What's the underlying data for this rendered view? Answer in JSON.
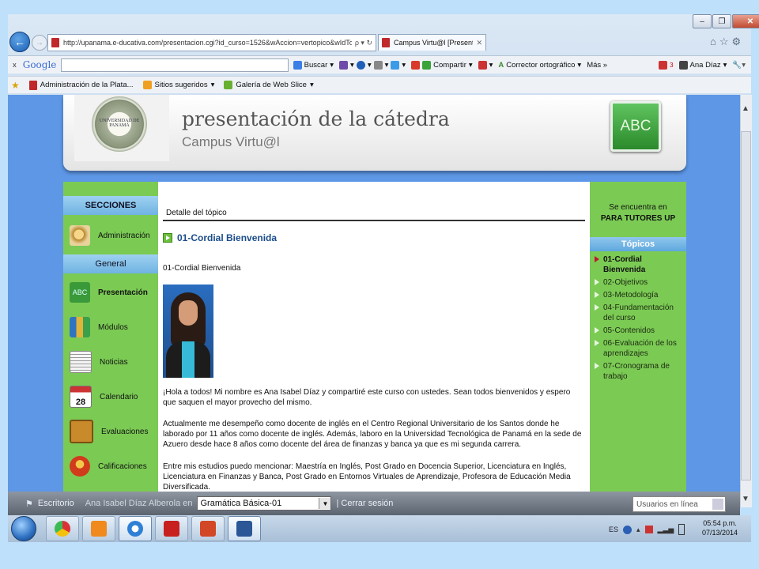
{
  "browser": {
    "window_controls": {
      "minimize": "‒",
      "restore": "❐",
      "close": "✕"
    },
    "address": "http://upanama.e-ducativa.com/presentacion.cgi?id_curso=1526&wAccion=vertopico&wIdTopico=",
    "address_tools": "ρ ▾ ↻",
    "tab_title": "Campus Virtu@l [Presentac...",
    "tab_close": "✕",
    "top_icons": "⌂☆⚙",
    "google_bar": {
      "close": "x",
      "logo": "Google",
      "search_button": "Buscar",
      "share": "Compartir",
      "spellcheck": "Corrector ortográfico",
      "more": "Más »",
      "user": "Ana Díaz",
      "badge": "3"
    },
    "favorites": [
      "Administración de la Plata...",
      "Sitios sugeridos",
      "Galería de Web Slice"
    ]
  },
  "site": {
    "seal_text": "UNIVERSIDAD DE PANAMÁ",
    "title": "presentación de la cátedra",
    "subtitle": "Campus Virtu@l",
    "abc": "ABC"
  },
  "left_menu": {
    "sections_header": "SECCIONES",
    "admin": "Administración",
    "general_header": "General",
    "items": [
      {
        "label": "Presentación",
        "icon": "abc-board-icon",
        "color": "#3a9a3a",
        "active": true
      },
      {
        "label": "Módulos",
        "icon": "binders-icon",
        "color": "#2f74c0",
        "active": false
      },
      {
        "label": "Noticias",
        "icon": "newspaper-icon",
        "color": "#dcdcdc",
        "active": false
      },
      {
        "label": "Calendario",
        "icon": "calendar-icon",
        "color": "#e8e8e8",
        "active": false
      },
      {
        "label": "Evaluaciones",
        "icon": "clipboard-icon",
        "color": "#c88a2a",
        "active": false
      },
      {
        "label": "Calificaciones",
        "icon": "ribbon-icon",
        "color": "#d23a1c",
        "active": false
      }
    ],
    "calendar_number": "28"
  },
  "content": {
    "detail_label": "Detalle del tópico",
    "topic_title": "01-Cordial Bienvenida",
    "topic_subtitle": "01-Cordial Bienvenida",
    "paragraphs": [
      "¡Hola a todos! Mi nombre es Ana Isabel Díaz y compartiré este curso con ustedes. Sean todos bienvenidos y espero que saquen el mayor provecho del mismo.",
      "Actualmente me desempeño como docente de inglés en el Centro Regional Universitario de los Santos donde he laborado por 11 años como docente de inglés. Además, laboro en la Universidad Tecnológica de Panamá en la sede de Azuero desde hace 8 años como docente del área de finanzas y banca ya que es mi segunda carrera.",
      "Entre mis estudios puedo mencionar: Maestría en Inglés, Post Grado en Docencia Superior, Licenciatura en Inglés, Licenciatura en Finanzas y Banca, Post Grado en Entornos Virtuales de Aprendizaje, Profesora de Educación Media Diversificada."
    ]
  },
  "right_panel": {
    "location_line1": "Se encuentra en",
    "location_line2": "PARA TUTORES UP",
    "topics_header": "Tópicos",
    "topics": [
      {
        "label": "01-Cordial Bienvenida",
        "active": true
      },
      {
        "label": "02-Objetivos",
        "active": false
      },
      {
        "label": "03-Metodología",
        "active": false
      },
      {
        "label": "04-Fundamentación del curso",
        "active": false
      },
      {
        "label": "05-Contenidos",
        "active": false
      },
      {
        "label": "06-Evaluación de los aprendizajes",
        "active": false
      },
      {
        "label": "07-Cronograma de trabajo",
        "active": false
      }
    ]
  },
  "bottom_bar": {
    "desk": "Escritorio",
    "user_in": "Ana Isabel Díaz Alberola en",
    "course": "Gramática Básica-01",
    "logout": "| Cerrar sesión",
    "users_online": "Usuarios en línea"
  },
  "taskbar": {
    "lang": "ES",
    "time": "05:54 p.m.",
    "date": "07/13/2014"
  },
  "colors": {
    "sidebar_green": "#7bca54",
    "page_blue": "#5d97e6",
    "topic_title": "#1b4c8a",
    "active_arrow": "#c0182b"
  }
}
